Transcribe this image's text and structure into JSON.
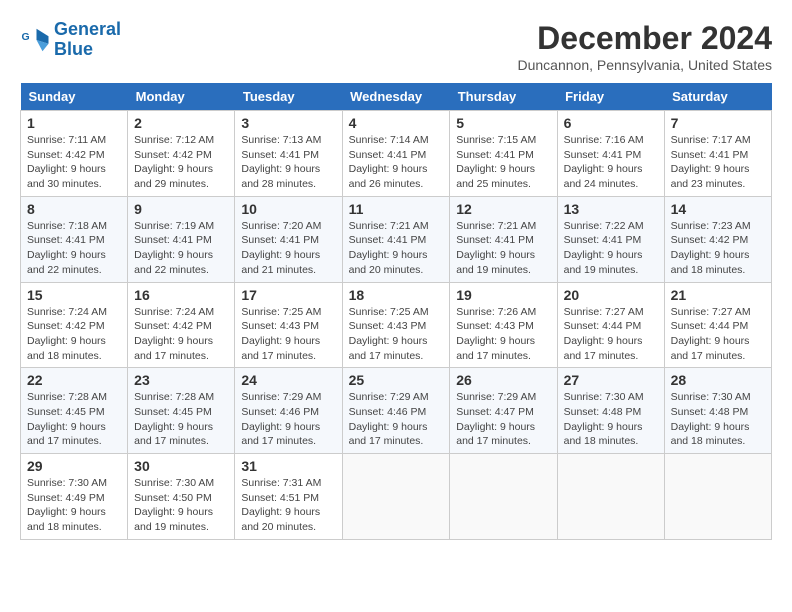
{
  "header": {
    "logo_line1": "General",
    "logo_line2": "Blue",
    "month_title": "December 2024",
    "location": "Duncannon, Pennsylvania, United States"
  },
  "days_of_week": [
    "Sunday",
    "Monday",
    "Tuesday",
    "Wednesday",
    "Thursday",
    "Friday",
    "Saturday"
  ],
  "weeks": [
    [
      {
        "day": "1",
        "sunrise": "7:11 AM",
        "sunset": "4:42 PM",
        "daylight": "9 hours and 30 minutes."
      },
      {
        "day": "2",
        "sunrise": "7:12 AM",
        "sunset": "4:42 PM",
        "daylight": "9 hours and 29 minutes."
      },
      {
        "day": "3",
        "sunrise": "7:13 AM",
        "sunset": "4:41 PM",
        "daylight": "9 hours and 28 minutes."
      },
      {
        "day": "4",
        "sunrise": "7:14 AM",
        "sunset": "4:41 PM",
        "daylight": "9 hours and 26 minutes."
      },
      {
        "day": "5",
        "sunrise": "7:15 AM",
        "sunset": "4:41 PM",
        "daylight": "9 hours and 25 minutes."
      },
      {
        "day": "6",
        "sunrise": "7:16 AM",
        "sunset": "4:41 PM",
        "daylight": "9 hours and 24 minutes."
      },
      {
        "day": "7",
        "sunrise": "7:17 AM",
        "sunset": "4:41 PM",
        "daylight": "9 hours and 23 minutes."
      }
    ],
    [
      {
        "day": "8",
        "sunrise": "7:18 AM",
        "sunset": "4:41 PM",
        "daylight": "9 hours and 22 minutes."
      },
      {
        "day": "9",
        "sunrise": "7:19 AM",
        "sunset": "4:41 PM",
        "daylight": "9 hours and 22 minutes."
      },
      {
        "day": "10",
        "sunrise": "7:20 AM",
        "sunset": "4:41 PM",
        "daylight": "9 hours and 21 minutes."
      },
      {
        "day": "11",
        "sunrise": "7:21 AM",
        "sunset": "4:41 PM",
        "daylight": "9 hours and 20 minutes."
      },
      {
        "day": "12",
        "sunrise": "7:21 AM",
        "sunset": "4:41 PM",
        "daylight": "9 hours and 19 minutes."
      },
      {
        "day": "13",
        "sunrise": "7:22 AM",
        "sunset": "4:41 PM",
        "daylight": "9 hours and 19 minutes."
      },
      {
        "day": "14",
        "sunrise": "7:23 AM",
        "sunset": "4:42 PM",
        "daylight": "9 hours and 18 minutes."
      }
    ],
    [
      {
        "day": "15",
        "sunrise": "7:24 AM",
        "sunset": "4:42 PM",
        "daylight": "9 hours and 18 minutes."
      },
      {
        "day": "16",
        "sunrise": "7:24 AM",
        "sunset": "4:42 PM",
        "daylight": "9 hours and 17 minutes."
      },
      {
        "day": "17",
        "sunrise": "7:25 AM",
        "sunset": "4:43 PM",
        "daylight": "9 hours and 17 minutes."
      },
      {
        "day": "18",
        "sunrise": "7:25 AM",
        "sunset": "4:43 PM",
        "daylight": "9 hours and 17 minutes."
      },
      {
        "day": "19",
        "sunrise": "7:26 AM",
        "sunset": "4:43 PM",
        "daylight": "9 hours and 17 minutes."
      },
      {
        "day": "20",
        "sunrise": "7:27 AM",
        "sunset": "4:44 PM",
        "daylight": "9 hours and 17 minutes."
      },
      {
        "day": "21",
        "sunrise": "7:27 AM",
        "sunset": "4:44 PM",
        "daylight": "9 hours and 17 minutes."
      }
    ],
    [
      {
        "day": "22",
        "sunrise": "7:28 AM",
        "sunset": "4:45 PM",
        "daylight": "9 hours and 17 minutes."
      },
      {
        "day": "23",
        "sunrise": "7:28 AM",
        "sunset": "4:45 PM",
        "daylight": "9 hours and 17 minutes."
      },
      {
        "day": "24",
        "sunrise": "7:29 AM",
        "sunset": "4:46 PM",
        "daylight": "9 hours and 17 minutes."
      },
      {
        "day": "25",
        "sunrise": "7:29 AM",
        "sunset": "4:46 PM",
        "daylight": "9 hours and 17 minutes."
      },
      {
        "day": "26",
        "sunrise": "7:29 AM",
        "sunset": "4:47 PM",
        "daylight": "9 hours and 17 minutes."
      },
      {
        "day": "27",
        "sunrise": "7:30 AM",
        "sunset": "4:48 PM",
        "daylight": "9 hours and 18 minutes."
      },
      {
        "day": "28",
        "sunrise": "7:30 AM",
        "sunset": "4:48 PM",
        "daylight": "9 hours and 18 minutes."
      }
    ],
    [
      {
        "day": "29",
        "sunrise": "7:30 AM",
        "sunset": "4:49 PM",
        "daylight": "9 hours and 18 minutes."
      },
      {
        "day": "30",
        "sunrise": "7:30 AM",
        "sunset": "4:50 PM",
        "daylight": "9 hours and 19 minutes."
      },
      {
        "day": "31",
        "sunrise": "7:31 AM",
        "sunset": "4:51 PM",
        "daylight": "9 hours and 20 minutes."
      },
      null,
      null,
      null,
      null
    ]
  ]
}
